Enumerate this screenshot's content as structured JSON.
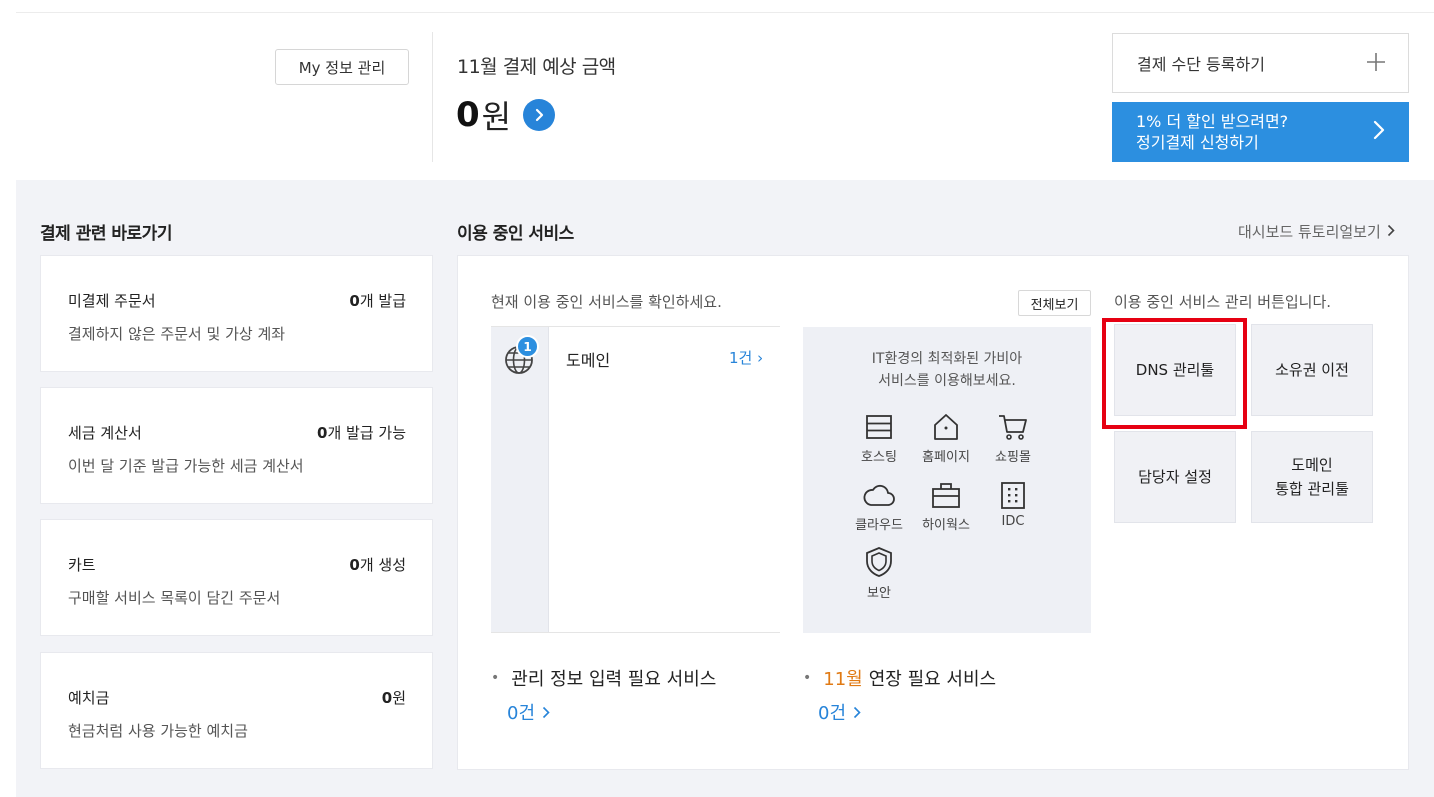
{
  "header": {
    "myinfo_label": "My 정보 관리",
    "bill_title": "11월 결제 예상 금액",
    "bill_amount": "0",
    "bill_unit": "원",
    "pay_register_label": "결제 수단 등록하기",
    "promo_line1": "1% 더 할인 받으려면?",
    "promo_line2": "정기결제 신청하기"
  },
  "shortcuts": {
    "title": "결제 관련 바로가기",
    "cards": [
      {
        "label": "미결제 주문서",
        "count": "0",
        "suffix": "개 발급",
        "desc": "결제하지 않은 주문서 및 가상 계좌"
      },
      {
        "label": "세금 계산서",
        "count": "0",
        "suffix": "개 발급 가능",
        "desc": "이번 달 기준 발급 가능한 세금 계산서"
      },
      {
        "label": "카트",
        "count": "0",
        "suffix": "개 생성",
        "desc": "구매할 서비스 목록이 담긴 주문서"
      },
      {
        "label": "예치금",
        "count": "0",
        "suffix": "원",
        "desc": "현금처럼 사용 가능한 예치금"
      }
    ]
  },
  "services": {
    "title": "이용 중인 서비스",
    "tutorial_label": "대시보드 튜토리얼보기",
    "hint": "현재 이용 중인 서비스를 확인하세요.",
    "viewall_label": "전체보기",
    "domain_badge": "1",
    "domain_name": "도메인",
    "domain_count": "1건",
    "promo_line1": "IT환경의 최적화된 가비아",
    "promo_line2": "서비스를 이용해보세요.",
    "promo_items": [
      "호스팅",
      "홈페이지",
      "쇼핑몰",
      "클라우드",
      "하이웍스",
      "IDC",
      "보안"
    ],
    "mgmt_hint": "이용 중인 서비스 관리 버튼입니다.",
    "mgmt_buttons": [
      "DNS 관리툴",
      "소유권 이전",
      "담당자 설정",
      "도메인",
      "통합 관리툴"
    ],
    "needs_info_label": "관리 정보 입력 필요 서비스",
    "needs_info_count": "0건",
    "renew_month": "11월",
    "renew_label": "연장 필요 서비스",
    "renew_count": "0건"
  },
  "colors": {
    "accent": "#2c8fe0",
    "highlight": "#e60012",
    "orange": "#e07a14"
  }
}
